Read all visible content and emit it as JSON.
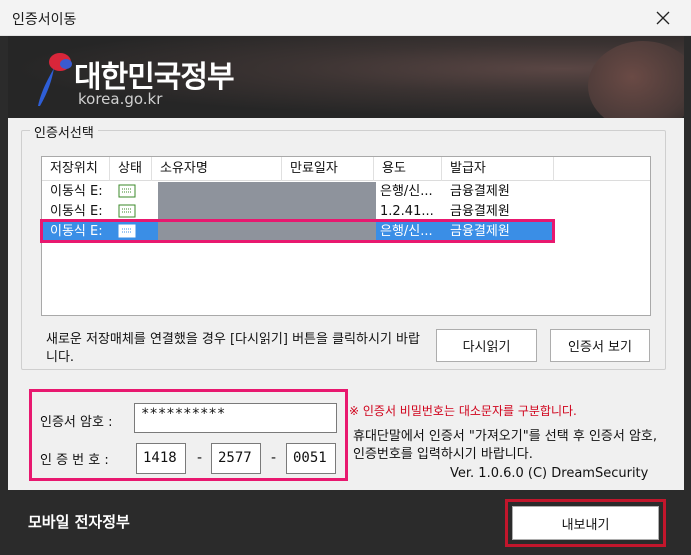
{
  "window": {
    "title": "인증서이동"
  },
  "banner": {
    "title": "대한민국정부",
    "subtitle": "korea.go.kr"
  },
  "cert_select": {
    "legend": "인증서선택",
    "columns": [
      "저장위치",
      "상태",
      "소유자명",
      "만료일자",
      "용도",
      "발급자"
    ],
    "rows": [
      {
        "location": "이동식 E:",
        "usage": "은행/신...",
        "issuer": "금융결제원"
      },
      {
        "location": "이동식 E:",
        "usage": "1.2.41...",
        "issuer": "금융결제원"
      },
      {
        "location": "이동식 E:",
        "usage": "은행/신...",
        "issuer": "금융결제원"
      }
    ],
    "selected_index": 2,
    "hint": "새로운 저장매체를 연결했을 경우 [다시읽기] 버튼을 클릭하시기 바랍니다.",
    "reload_button": "다시읽기",
    "view_button": "인증서 보기"
  },
  "auth": {
    "password_label": "인증서 암호 :",
    "password_value": "**********",
    "auth_label": "인 증  번 호 :",
    "auth_parts": [
      "1418",
      "2577",
      "0051"
    ],
    "dash": "-"
  },
  "notice": {
    "warning": "※ 인증서 비밀번호는 대소문자를 구분합니다.",
    "info": "휴대단말에서 인증서 \"가져오기\"를 선택 후 인증서 암호, 인증번호를 입력하시기 바랍니다.",
    "version": "Ver. 1.0.6.0  (C) DreamSecurity"
  },
  "footer": {
    "mobile_label": "모바일 전자정부",
    "export_button": "내보내기"
  },
  "colors": {
    "highlight": "#e8186f",
    "selection": "#3a8ee6",
    "warning": "#d0021b",
    "mask": "#8e939c"
  }
}
